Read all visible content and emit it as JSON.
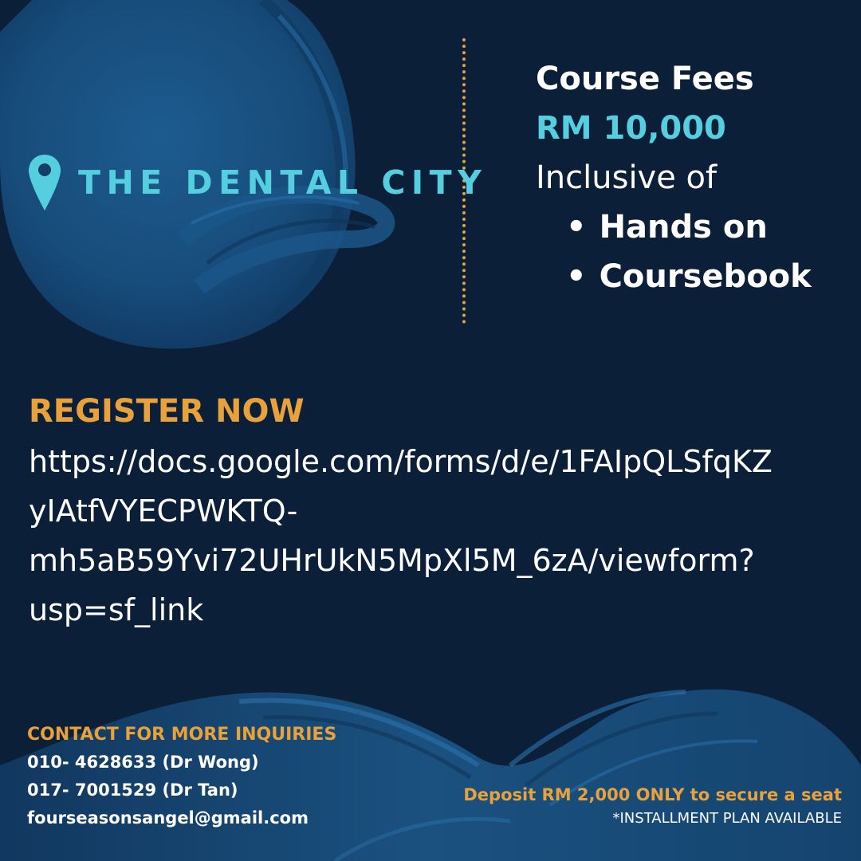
{
  "brand": {
    "name": "THE DENTAL CITY",
    "icon": "location-pin-icon"
  },
  "fees": {
    "title": "Course Fees",
    "amount": "RM 10,000",
    "inclusive": "Inclusive of",
    "items": [
      "Hands on",
      "Coursebook"
    ]
  },
  "register": {
    "title": "REGISTER NOW",
    "link_lines": [
      "https://docs.google.com/forms/d/e/1FAIpQLSfqKZ",
      "yIAtfVYECPWKTQ-",
      "mh5aB59Yvi72UHrUkN5MpXl5M_6zA/viewform?",
      "usp=sf_link"
    ]
  },
  "contact": {
    "title": "CONTACT FOR MORE INQUIRIES",
    "lines": [
      "010- 4628633 (Dr Wong)",
      "017- 7001529 (Dr Tan)",
      "fourseasonsangel@gmail.com"
    ]
  },
  "deposit": {
    "text": "Deposit RM 2,000 ONLY  to secure a seat"
  },
  "installment": {
    "text": "*INSTALLMENT PLAN AVAILABLE"
  },
  "colors": {
    "background": "#0c1f38",
    "accent_cyan": "#55cfe0",
    "accent_orange": "#e9a23b",
    "brush_blue": "#1d5a8c"
  }
}
